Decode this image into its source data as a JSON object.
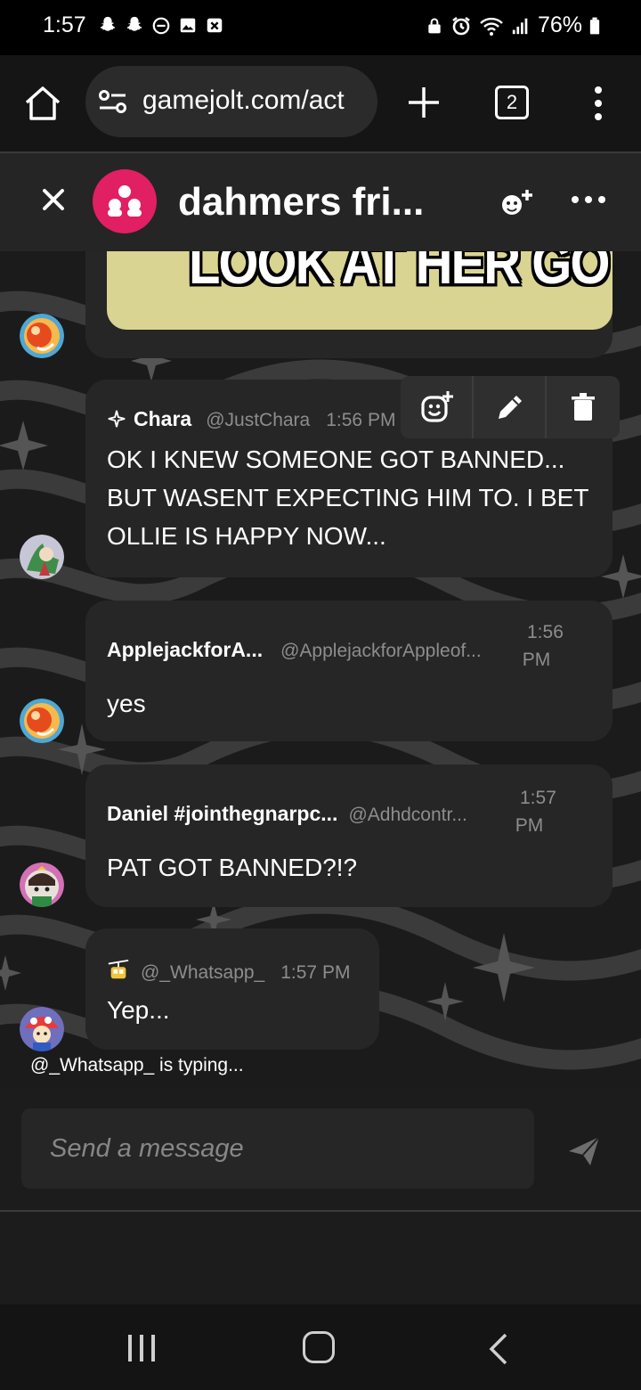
{
  "status_bar": {
    "time": "1:57",
    "battery": "76%",
    "icons_left": [
      "snapchat-icon",
      "snapchat-icon",
      "dnd-icon",
      "gallery-icon",
      "close-box-icon"
    ],
    "icons_right": [
      "lock-icon",
      "alarm-icon",
      "wifi-icon",
      "signal-icon",
      "battery-icon"
    ]
  },
  "browser": {
    "url": "gamejolt.com/act",
    "tab_count": "2"
  },
  "chat": {
    "title": "dahmers fri...",
    "accent_color": "#e11f63",
    "meme_caption": "LOOK AT HER GO",
    "messages": [
      {
        "author": "Chara",
        "handle": "@JustChara",
        "time": "1:56 PM",
        "text": "OK I KNEW SOMEONE GOT BANNED... BUT WASENT EXPECTING HIM TO. I BET OLLIE IS HAPPY NOW..."
      },
      {
        "author": "ApplejackforA...",
        "handle": "@ApplejackforAppleof...",
        "time_line1": "1:56",
        "time_line2": "PM",
        "text": "yes"
      },
      {
        "author": "Daniel #jointhegnarpc...",
        "handle": "@Adhdcontr...",
        "time_line1": "1:57",
        "time_line2": "PM",
        "text": "PAT GOT BANNED?!?"
      },
      {
        "author": "",
        "handle": "@_Whatsapp_",
        "time": "1:57 PM",
        "text": "Yep..."
      }
    ],
    "typing_indicator": "@_Whatsapp_ is typing..."
  },
  "composer": {
    "placeholder": "Send a message"
  }
}
